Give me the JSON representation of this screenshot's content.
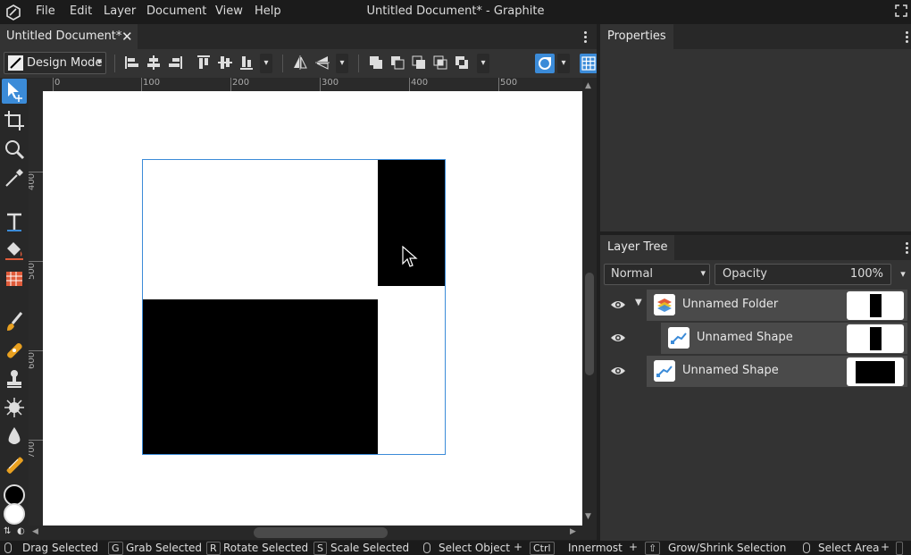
{
  "app": {
    "window_title": "Untitled Document* - Graphite",
    "menu": [
      "File",
      "Edit",
      "Layer",
      "Document",
      "View",
      "Help"
    ]
  },
  "document_tab": {
    "label": "Untitled Document*",
    "close_glyph": "✕"
  },
  "options_bar": {
    "mode_label": "Design Mode"
  },
  "ruler": {
    "top_labels": [
      "0",
      "100",
      "200",
      "300",
      "400",
      "500"
    ],
    "left_labels": [
      "400",
      "500",
      "600",
      "700"
    ]
  },
  "panels": {
    "properties_title": "Properties",
    "layer_tree_title": "Layer Tree"
  },
  "layer_tree": {
    "blend_mode": "Normal",
    "opacity_label": "Opacity",
    "opacity_value": "100%",
    "layers": [
      {
        "name": "Unnamed Folder",
        "kind": "folder",
        "expanded": true
      },
      {
        "name": "Unnamed Shape",
        "kind": "shape",
        "indent": true
      },
      {
        "name": "Unnamed Shape",
        "kind": "shape",
        "indent": false
      }
    ]
  },
  "status_bar": {
    "drag_selected": "Drag Selected",
    "grab_key": "G",
    "grab_selected": "Grab Selected",
    "rotate_key": "R",
    "rotate_selected": "Rotate Selected",
    "scale_key": "S",
    "scale_selected": "Scale Selected",
    "select_object": "Select Object",
    "ctrl_key": "Ctrl",
    "innermost": "Innermost",
    "shift_key": "⇧",
    "grow_shrink": "Grow/Shrink Selection",
    "select_area": "Select Area"
  },
  "colors": {
    "accent": "#3b8bd8",
    "primary_color": "#000000",
    "secondary_color": "#ffffff"
  }
}
